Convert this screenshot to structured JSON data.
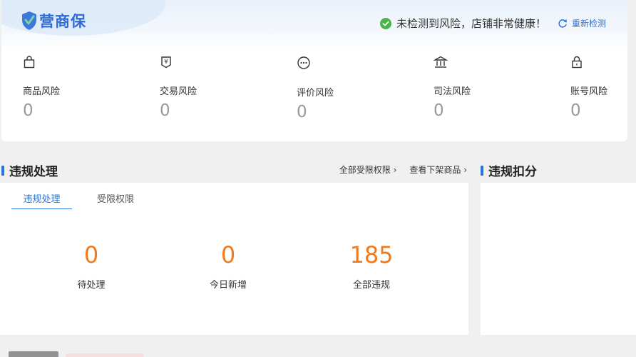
{
  "brand": {
    "name": "营商保",
    "accent": "#2a74d6"
  },
  "status": {
    "message": "未检测到风险，店铺非常健康！",
    "recheck_label": "重新检测"
  },
  "risks": [
    {
      "label": "商品风险",
      "value": "0",
      "icon": "shopping-bag-icon"
    },
    {
      "label": "交易风险",
      "value": "0",
      "icon": "yen-tag-icon"
    },
    {
      "label": "评价风险",
      "value": "0",
      "icon": "chat-bubble-icon"
    },
    {
      "label": "司法风险",
      "value": "0",
      "icon": "court-icon"
    },
    {
      "label": "账号风险",
      "value": "0",
      "icon": "lock-icon"
    }
  ],
  "violation": {
    "title": "违规处理",
    "links": [
      "全部受限权限 ›",
      "查看下架商品 ›"
    ],
    "tabs": [
      "违规处理",
      "受限权限"
    ],
    "stats": [
      {
        "value": "0",
        "label": "待处理"
      },
      {
        "value": "0",
        "label": "今日新增"
      },
      {
        "value": "185",
        "label": "全部违规"
      }
    ]
  },
  "deduction": {
    "title": "违规扣分"
  }
}
